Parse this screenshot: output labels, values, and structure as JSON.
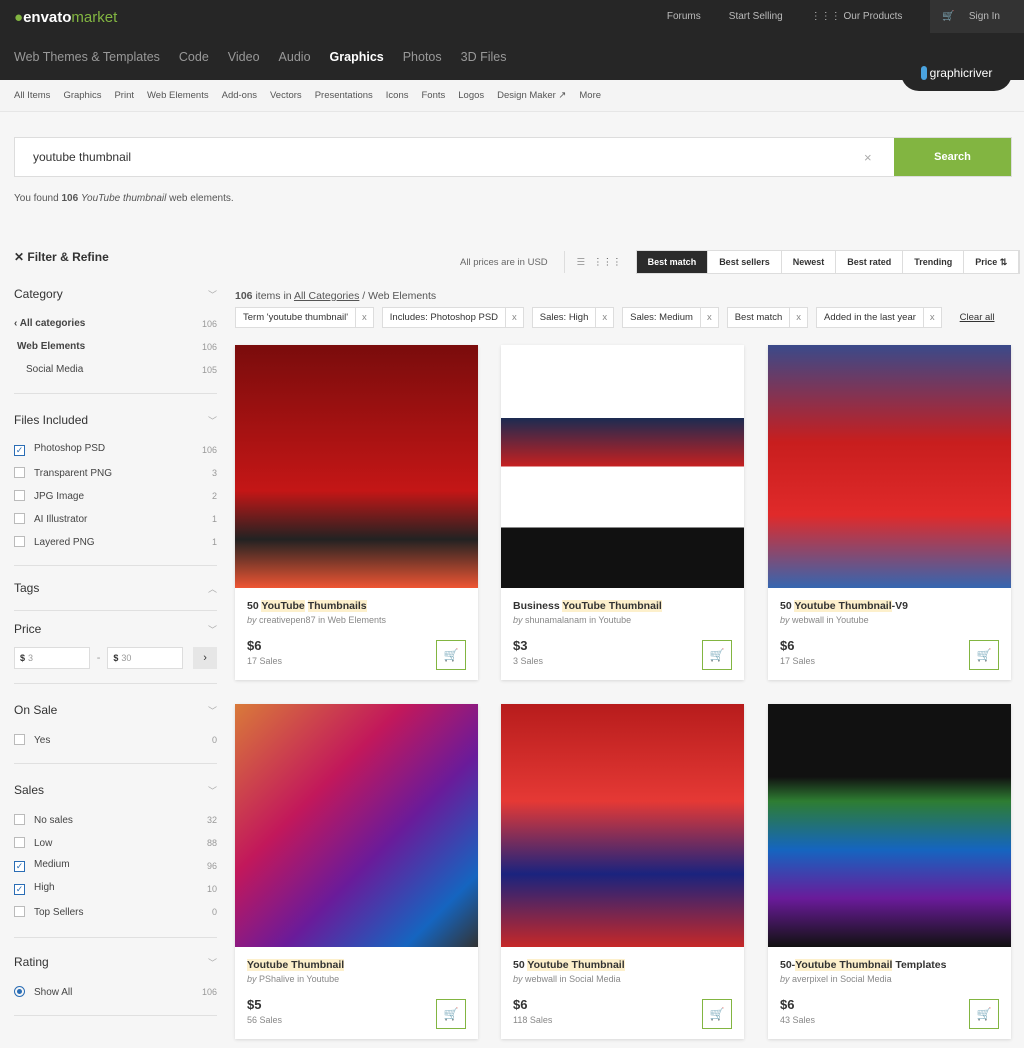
{
  "header": {
    "logo_a": "envato",
    "logo_b": "market",
    "links": [
      "Forums",
      "Start Selling",
      "Our Products"
    ],
    "signin": "Sign In",
    "nav": [
      "Web Themes & Templates",
      "Code",
      "Video",
      "Audio",
      "Graphics",
      "Photos",
      "3D Files"
    ],
    "brand": "graphicriver"
  },
  "subnav": [
    "All Items",
    "Graphics",
    "Print",
    "Web Elements",
    "Add-ons",
    "Vectors",
    "Presentations",
    "Icons",
    "Fonts",
    "Logos",
    "Design Maker ↗",
    "More"
  ],
  "search": {
    "value": "youtube thumbnail",
    "button": "Search"
  },
  "found": {
    "a": "You found ",
    "n": "106",
    "term": "YouTube thumbnail",
    "b": " web elements."
  },
  "sidebar": {
    "title": "Filter & Refine",
    "category": {
      "title": "Category",
      "items": [
        {
          "l": "All categories",
          "c": "106"
        },
        {
          "l": "Web Elements",
          "c": "106"
        },
        {
          "l": "Social Media",
          "c": "105"
        }
      ]
    },
    "files": {
      "title": "Files Included",
      "items": [
        {
          "l": "Photoshop PSD",
          "c": "106",
          "on": true
        },
        {
          "l": "Transparent PNG",
          "c": "3"
        },
        {
          "l": "JPG Image",
          "c": "2"
        },
        {
          "l": "AI Illustrator",
          "c": "1"
        },
        {
          "l": "Layered PNG",
          "c": "1"
        }
      ]
    },
    "tags": {
      "title": "Tags"
    },
    "price": {
      "title": "Price",
      "cur": "$",
      "min": "3",
      "max": "30",
      "sep": "-",
      "go": "›"
    },
    "onsale": {
      "title": "On Sale",
      "items": [
        {
          "l": "Yes",
          "c": "0"
        }
      ]
    },
    "sales": {
      "title": "Sales",
      "items": [
        {
          "l": "No sales",
          "c": "32"
        },
        {
          "l": "Low",
          "c": "88"
        },
        {
          "l": "Medium",
          "c": "96",
          "on": true
        },
        {
          "l": "High",
          "c": "10",
          "on": true
        },
        {
          "l": "Top Sellers",
          "c": "0"
        }
      ]
    },
    "rating": {
      "title": "Rating",
      "items": [
        {
          "l": "Show All",
          "c": "106"
        }
      ]
    }
  },
  "toolbar": {
    "usd": "All prices are in USD",
    "sorts": [
      "Best match",
      "Best sellers",
      "Newest",
      "Best rated",
      "Trending",
      "Price ⇅"
    ]
  },
  "results": {
    "n": "106",
    "a": " items in ",
    "cat": "All Categories",
    "b": " / Web Elements"
  },
  "chips": [
    "Term 'youtube thumbnail'",
    "Includes: Photoshop PSD",
    "Sales: High",
    "Sales: Medium",
    "Best match",
    "Added in the last year"
  ],
  "clear_all": "Clear all",
  "cards": [
    {
      "title": [
        [
          "50 ",
          0
        ],
        [
          "YouTube",
          1
        ],
        [
          " ",
          0
        ],
        [
          "Thumbnails",
          1
        ]
      ],
      "author": "creativepen87",
      "cat": "Web Elements",
      "price": "$6",
      "sales": "17 Sales",
      "bg": "linear-gradient(#7a0c0c,#c41616 60%,#222 80%,#e53 100%)"
    },
    {
      "title": [
        [
          "Business ",
          0
        ],
        [
          "YouTube Thumbnail",
          1
        ]
      ],
      "author": "shunamalanam",
      "cat": "Youtube",
      "price": "$3",
      "sales": "3 Sales",
      "bg": "linear-gradient(#fff 30%,#1b2b52 30%,#c62020 50%,#fff 50%,#fff 75%,#111 75%)"
    },
    {
      "title": [
        [
          "50 ",
          0
        ],
        [
          "Youtube Thumbnail",
          1
        ],
        [
          "-V9",
          0
        ]
      ],
      "author": "webwall",
      "cat": "Youtube",
      "price": "$6",
      "sales": "17 Sales",
      "bg": "linear-gradient(#3a4a8a,#c81e1e 40%,#e02a2a 70%,#3566b0)"
    },
    {
      "title": [
        [
          "Youtube Thumbnail",
          1
        ]
      ],
      "author": "PShalive",
      "cat": "Youtube",
      "price": "$5",
      "sales": "56 Sales",
      "bg": "linear-gradient(135deg,#d97a3a,#c2185b 35%,#6a1b9a 60%,#1565c0 85%,#333)"
    },
    {
      "title": [
        [
          "50 ",
          0
        ],
        [
          "Youtube Thumbnail",
          1
        ]
      ],
      "author": "webwall",
      "cat": "Social Media",
      "price": "$6",
      "sales": "118 Sales",
      "bg": "linear-gradient(#b71c1c,#e53935 40%,#1a237e 70%,#c62828)"
    },
    {
      "title": [
        [
          "50-",
          0
        ],
        [
          "Youtube Thumbnail",
          1
        ],
        [
          " Templates",
          0
        ]
      ],
      "author": "averpixel",
      "cat": "Social Media",
      "price": "$6",
      "sales": "43 Sales",
      "bg": "linear-gradient(#111 30%,#2e7d32 40%,#1565c0 60%,#6a1b9a 80%,#111)"
    }
  ],
  "by_word": "by",
  "in_word": " in "
}
